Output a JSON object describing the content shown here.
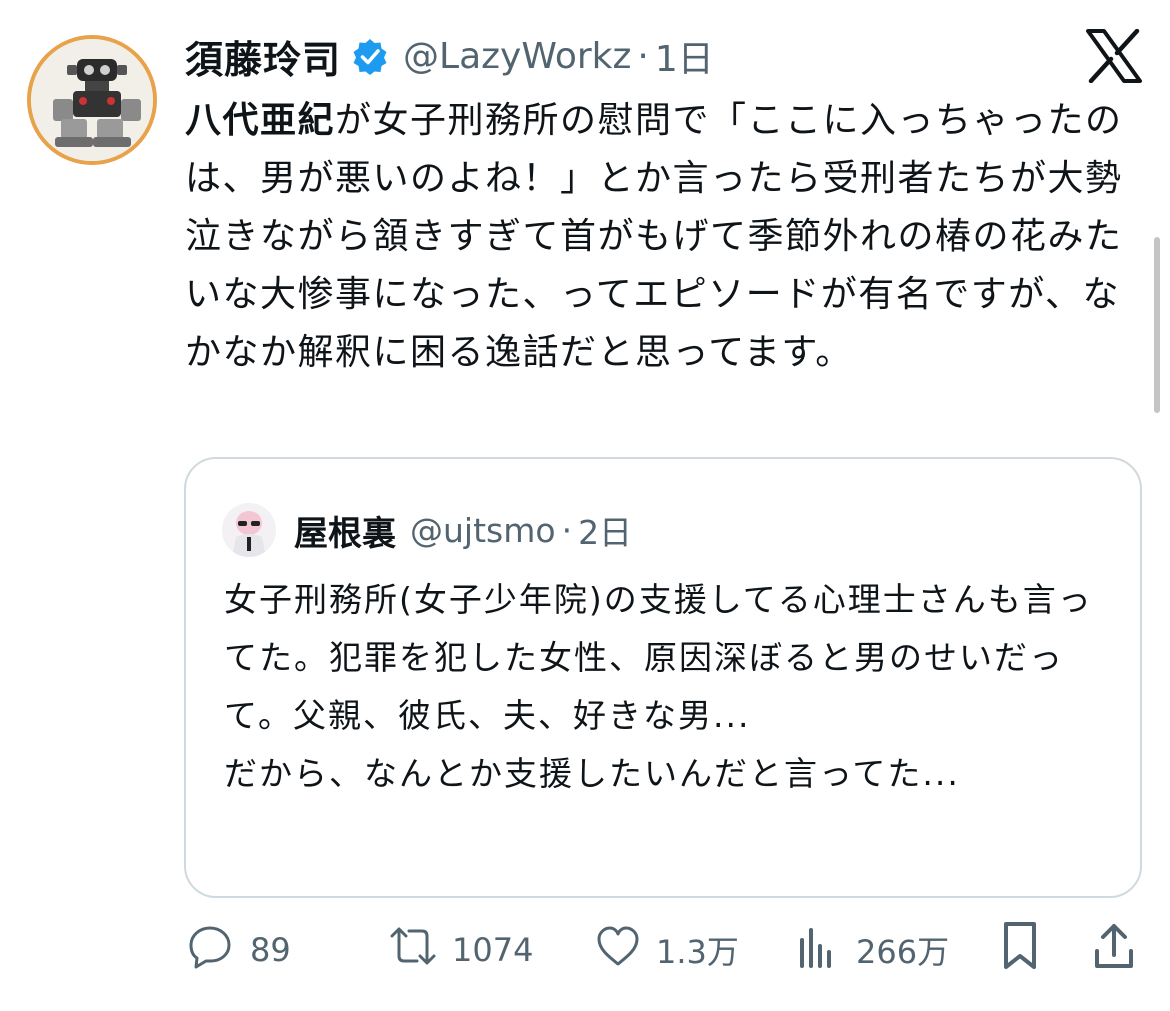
{
  "tweet": {
    "author_name": "須藤玲司",
    "author_handle": "@LazyWorkz",
    "separator": "·",
    "time": "1日",
    "text_bold": "八代亜紀",
    "text_rest": "が女子刑務所の慰問で「ここに入っちゃったのは、男が悪いのよね！」とか言ったら受刑者たちが大勢泣きながら頷きすぎて首がもげて季節外れの椿の花みたいな大惨事になった、ってエピソードが有名ですが、なかなか解釈に困る逸話だと思ってます。"
  },
  "quote": {
    "author_name": "屋根裏",
    "author_handle": "@ujtsmo",
    "separator": "·",
    "time": "2日",
    "text": "女子刑務所(女子少年院)の支援してる心理士さんも言ってた。犯罪を犯した女性、原因深ぼると男のせいだって。父親、彼氏、夫、好きな男...\nだから、なんとか支援したいんだと言ってた..."
  },
  "actions": {
    "replies": "89",
    "reposts": "1074",
    "likes": "1.3万",
    "views": "266万"
  },
  "icons": {
    "verified": "verified-badge-icon",
    "platform": "x-logo-icon",
    "reply": "reply-icon",
    "repost": "repost-icon",
    "like": "heart-icon",
    "views": "views-icon",
    "bookmark": "bookmark-icon",
    "share": "share-icon"
  },
  "colors": {
    "text": "#0f1419",
    "secondary": "#536471",
    "verified": "#1d9bf0",
    "border": "#cfd9de"
  }
}
